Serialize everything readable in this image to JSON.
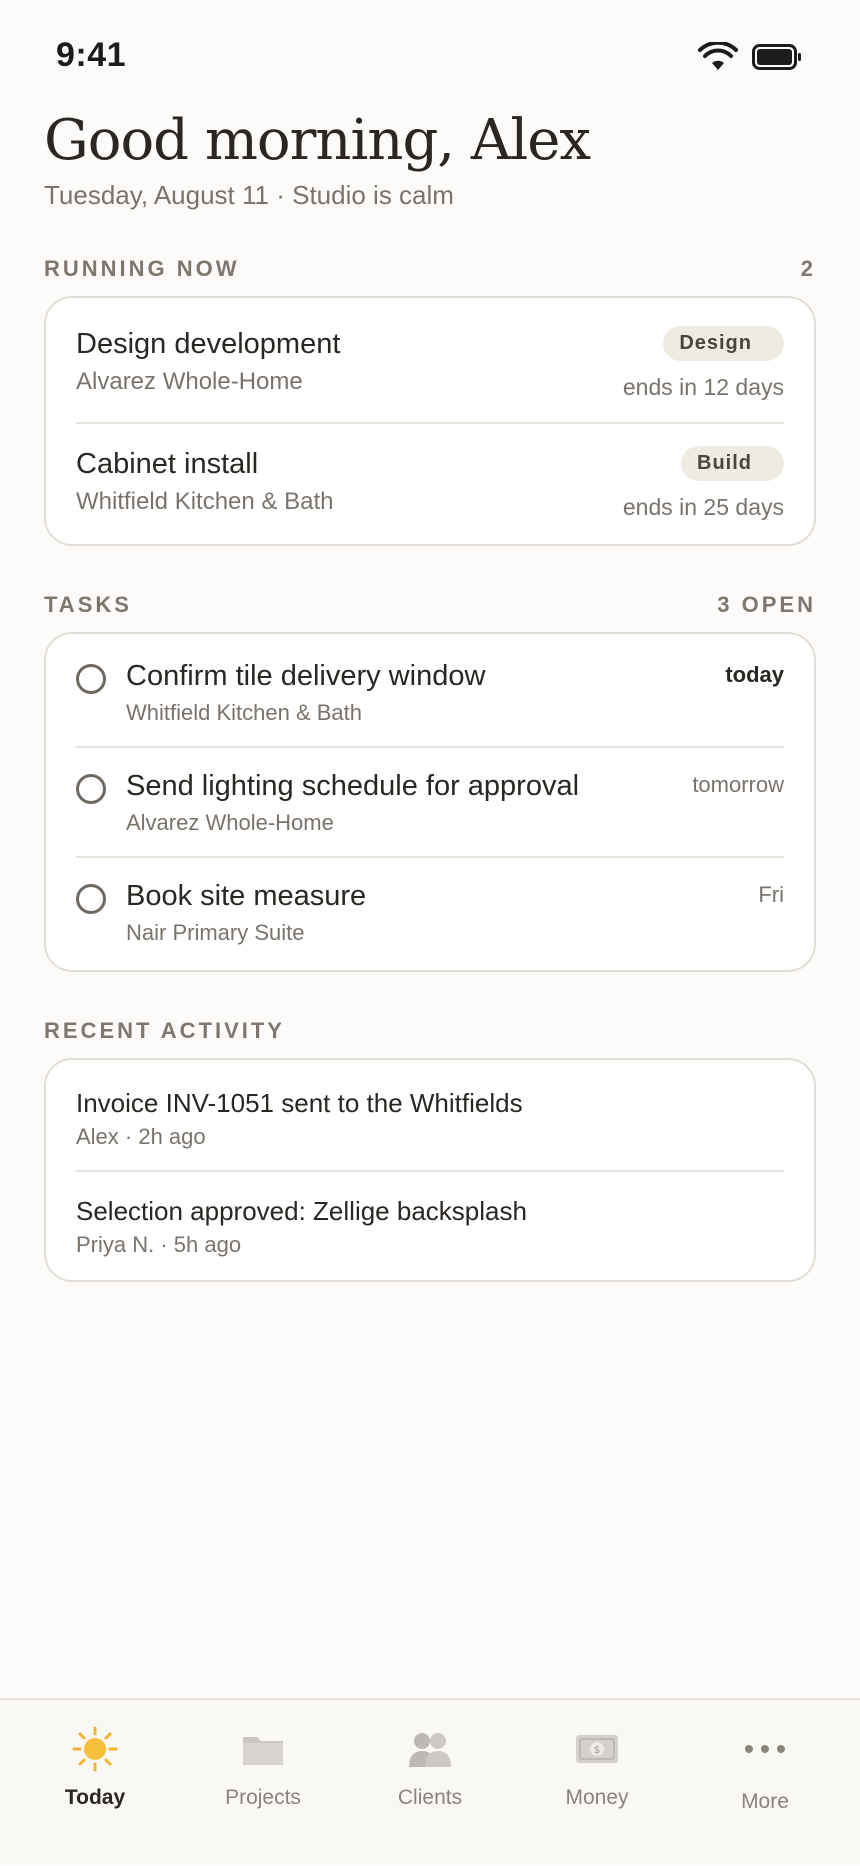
{
  "status": {
    "time": "9:41"
  },
  "header": {
    "greeting": "Good morning, Alex",
    "subline": "Tuesday, August 11 · Studio is calm"
  },
  "running": {
    "title": "RUNNING NOW",
    "count": "2",
    "items": [
      {
        "title": "Design development",
        "client": "Alvarez Whole-Home",
        "tag": "Design",
        "ends": "ends in 12 days"
      },
      {
        "title": "Cabinet install",
        "client": "Whitfield Kitchen & Bath",
        "tag": "Build",
        "ends": "ends in 25 days"
      }
    ]
  },
  "tasks": {
    "title": "TASKS",
    "count": "3 OPEN",
    "items": [
      {
        "title": "Confirm tile delivery window",
        "client": "Whitfield Kitchen & Bath",
        "due": "today"
      },
      {
        "title": "Send lighting schedule for approval",
        "client": "Alvarez Whole-Home",
        "due": "tomorrow"
      },
      {
        "title": "Book site measure",
        "client": "Nair Primary Suite",
        "due": "Fri"
      }
    ]
  },
  "activity": {
    "title": "RECENT ACTIVITY",
    "items": [
      {
        "title": "Invoice INV-1051 sent to the Whitfields",
        "meta": "Alex · 2h ago"
      },
      {
        "title": "Selection approved: Zellige backsplash",
        "meta": "Priya N. · 5h ago"
      }
    ]
  },
  "tabbar": {
    "items": [
      {
        "label": "Today",
        "icon": "sun-icon",
        "active": true
      },
      {
        "label": "Projects",
        "icon": "folder-icon"
      },
      {
        "label": "Clients",
        "icon": "people-icon"
      },
      {
        "label": "Money",
        "icon": "banknote-icon"
      },
      {
        "label": "More",
        "icon": "more-icon"
      }
    ]
  },
  "colors": {
    "background": "#FCFBF9",
    "card_border": "#E2DDD5",
    "pill": "#EFEBE3",
    "accent_sun": "#F4B22E"
  }
}
